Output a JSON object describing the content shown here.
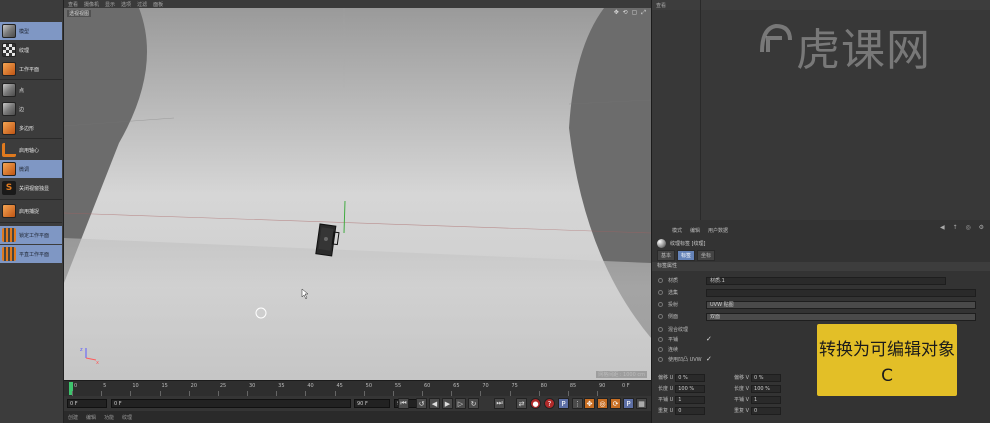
{
  "left_panel": {
    "header": "",
    "tools": [
      {
        "label": "模型",
        "icon": "cube-icon"
      },
      {
        "label": "纹理",
        "icon": "checker-icon"
      },
      {
        "label": "工作平面",
        "icon": "workplane-icon"
      },
      {
        "label": "点",
        "icon": "cube-points-icon"
      },
      {
        "label": "边",
        "icon": "cube-edges-icon"
      },
      {
        "label": "多边形",
        "icon": "cube-polygons-icon"
      },
      {
        "label": "启用轴心",
        "icon": "axis-icon"
      },
      {
        "label": "微调",
        "icon": "tweak-icon"
      },
      {
        "label": "关闭视窗独显",
        "icon": "solo-icon"
      },
      {
        "label": "启用捕捉",
        "icon": "snap-icon"
      },
      {
        "label": "锁定工作平面",
        "icon": "lock-workplane-icon"
      },
      {
        "label": "平直工作平面",
        "icon": "planar-workplane-icon"
      }
    ]
  },
  "viewport": {
    "menu": [
      "查看",
      "摄像机",
      "显示",
      "选项",
      "过滤",
      "面板"
    ],
    "label": "透视视图",
    "grid_label": "网格间距 : 1000 cm"
  },
  "timeline": {
    "ticks": [
      "0",
      "5",
      "10",
      "15",
      "20",
      "25",
      "30",
      "35",
      "40",
      "45",
      "50",
      "55",
      "60",
      "65",
      "70",
      "75",
      "80",
      "85",
      "90"
    ],
    "end_label": "0 F"
  },
  "transport": {
    "current_frame": "0 F",
    "min_field": "0 F",
    "max_field": "90 F",
    "end_field": "90 F"
  },
  "bottom_menu": [
    "创建",
    "编辑",
    "功能",
    "纹理"
  ],
  "object_manager": {
    "tabs": [
      "查看"
    ],
    "watermark": "虎课网"
  },
  "attributes": {
    "menu": [
      "模式",
      "编辑",
      "用户数据"
    ],
    "title": "纹理标签 [纹理]",
    "tabs": [
      {
        "label": "基本",
        "active": false
      },
      {
        "label": "标签",
        "active": true
      },
      {
        "label": "坐标",
        "active": false
      }
    ],
    "section": "标签属性",
    "props": [
      {
        "label": "材质",
        "value": "材质.1"
      },
      {
        "label": "选集",
        "value": ""
      },
      {
        "label": "投射",
        "value": "UVW 贴图"
      },
      {
        "label": "侧面",
        "value": "双面"
      },
      {
        "label": "混合纹理",
        "value": ""
      },
      {
        "label": "平铺",
        "value": "✓"
      },
      {
        "label": "连续",
        "value": ""
      },
      {
        "label": "使用凹凸 UVW",
        "value": "✓"
      }
    ],
    "pairs": [
      {
        "l1": "偏移 U",
        "v1": "0 %",
        "l2": "偏移 V",
        "v2": "0 %"
      },
      {
        "l1": "长度 U",
        "v1": "100 %",
        "l2": "长度 V",
        "v2": "100 %"
      },
      {
        "l1": "平铺 U",
        "v1": "1",
        "l2": "平铺 V",
        "v2": "1"
      },
      {
        "l1": "重复 U",
        "v1": "0",
        "l2": "重复 V",
        "v2": "0"
      }
    ]
  },
  "shortcut": {
    "title": "转换为可编辑对象",
    "key": "C"
  },
  "colors": {
    "highlight": "#7f97c4",
    "shortcut_bg": "#e3bf27",
    "playhead": "#3ec46d"
  }
}
